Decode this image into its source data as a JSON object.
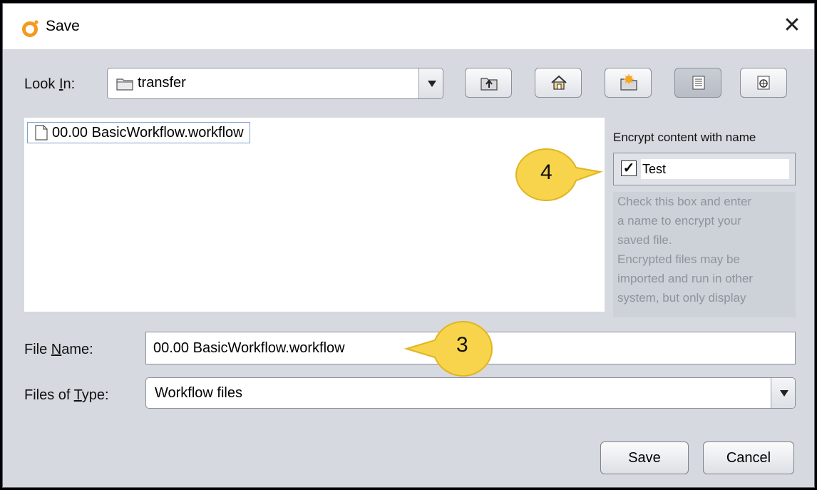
{
  "window": {
    "title": "Save",
    "close_glyph": "✕"
  },
  "look_in": {
    "label_pre": "Look ",
    "label_key": "I",
    "label_post": "n:",
    "value": "transfer"
  },
  "toolbar": {
    "buttons": [
      {
        "name": "up-one-level-button",
        "icon": "folder-up-icon"
      },
      {
        "name": "home-button",
        "icon": "home-icon"
      },
      {
        "name": "create-new-folder-button",
        "icon": "new-folder-icon"
      },
      {
        "name": "list-view-button",
        "icon": "list-view-icon",
        "selected": true
      },
      {
        "name": "details-view-button",
        "icon": "details-view-icon"
      }
    ]
  },
  "file_list": {
    "items": [
      "00.00 BasicWorkflow.workflow"
    ]
  },
  "encrypt": {
    "title": "Encrypt content with name",
    "checked": true,
    "check_glyph": "✓",
    "name_value": "Test",
    "help_lines": [
      "Check this box and enter",
      "a name to encrypt your",
      "saved file.",
      "Encrypted files may be",
      "imported and run in other",
      "system, but only display"
    ]
  },
  "file_name": {
    "label_pre": "File ",
    "label_key": "N",
    "label_post": "ame:",
    "value": "00.00 BasicWorkflow.workflow"
  },
  "file_type": {
    "label_pre": "Files of ",
    "label_key": "T",
    "label_post": "ype:",
    "value": "Workflow files"
  },
  "buttons": {
    "save": "Save",
    "cancel": "Cancel"
  },
  "callouts": {
    "three": "3",
    "four": "4"
  },
  "colors": {
    "callout_fill": "#f7d44c",
    "callout_stroke": "#e0b520",
    "dialog_bg": "#d6d9df",
    "selection_border": "#7da2ce"
  }
}
